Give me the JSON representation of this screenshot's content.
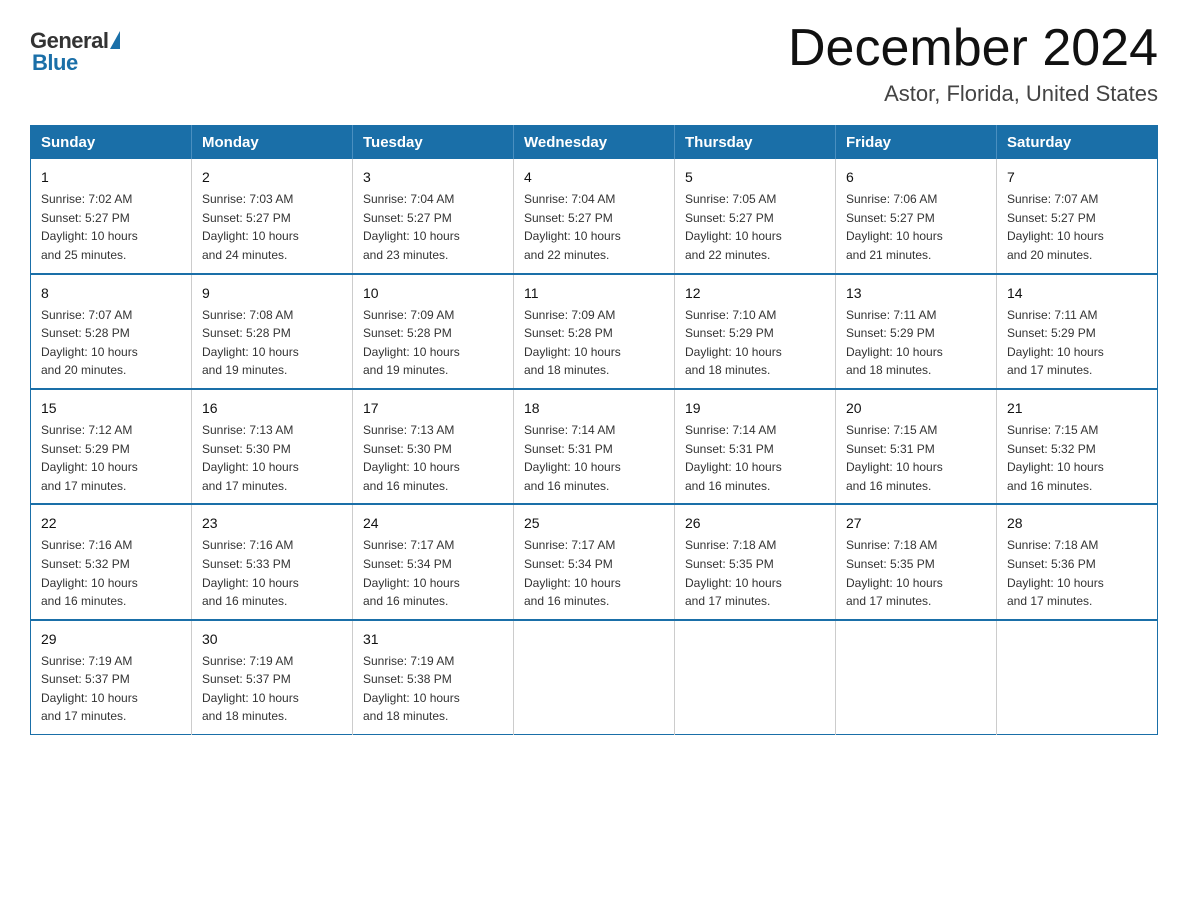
{
  "logo": {
    "text_general": "General",
    "text_blue": "Blue"
  },
  "title": {
    "month_year": "December 2024",
    "location": "Astor, Florida, United States"
  },
  "weekdays": [
    "Sunday",
    "Monday",
    "Tuesday",
    "Wednesday",
    "Thursday",
    "Friday",
    "Saturday"
  ],
  "weeks": [
    [
      {
        "day": "1",
        "sunrise": "7:02 AM",
        "sunset": "5:27 PM",
        "daylight": "10 hours and 25 minutes."
      },
      {
        "day": "2",
        "sunrise": "7:03 AM",
        "sunset": "5:27 PM",
        "daylight": "10 hours and 24 minutes."
      },
      {
        "day": "3",
        "sunrise": "7:04 AM",
        "sunset": "5:27 PM",
        "daylight": "10 hours and 23 minutes."
      },
      {
        "day": "4",
        "sunrise": "7:04 AM",
        "sunset": "5:27 PM",
        "daylight": "10 hours and 22 minutes."
      },
      {
        "day": "5",
        "sunrise": "7:05 AM",
        "sunset": "5:27 PM",
        "daylight": "10 hours and 22 minutes."
      },
      {
        "day": "6",
        "sunrise": "7:06 AM",
        "sunset": "5:27 PM",
        "daylight": "10 hours and 21 minutes."
      },
      {
        "day": "7",
        "sunrise": "7:07 AM",
        "sunset": "5:27 PM",
        "daylight": "10 hours and 20 minutes."
      }
    ],
    [
      {
        "day": "8",
        "sunrise": "7:07 AM",
        "sunset": "5:28 PM",
        "daylight": "10 hours and 20 minutes."
      },
      {
        "day": "9",
        "sunrise": "7:08 AM",
        "sunset": "5:28 PM",
        "daylight": "10 hours and 19 minutes."
      },
      {
        "day": "10",
        "sunrise": "7:09 AM",
        "sunset": "5:28 PM",
        "daylight": "10 hours and 19 minutes."
      },
      {
        "day": "11",
        "sunrise": "7:09 AM",
        "sunset": "5:28 PM",
        "daylight": "10 hours and 18 minutes."
      },
      {
        "day": "12",
        "sunrise": "7:10 AM",
        "sunset": "5:29 PM",
        "daylight": "10 hours and 18 minutes."
      },
      {
        "day": "13",
        "sunrise": "7:11 AM",
        "sunset": "5:29 PM",
        "daylight": "10 hours and 18 minutes."
      },
      {
        "day": "14",
        "sunrise": "7:11 AM",
        "sunset": "5:29 PM",
        "daylight": "10 hours and 17 minutes."
      }
    ],
    [
      {
        "day": "15",
        "sunrise": "7:12 AM",
        "sunset": "5:29 PM",
        "daylight": "10 hours and 17 minutes."
      },
      {
        "day": "16",
        "sunrise": "7:13 AM",
        "sunset": "5:30 PM",
        "daylight": "10 hours and 17 minutes."
      },
      {
        "day": "17",
        "sunrise": "7:13 AM",
        "sunset": "5:30 PM",
        "daylight": "10 hours and 16 minutes."
      },
      {
        "day": "18",
        "sunrise": "7:14 AM",
        "sunset": "5:31 PM",
        "daylight": "10 hours and 16 minutes."
      },
      {
        "day": "19",
        "sunrise": "7:14 AM",
        "sunset": "5:31 PM",
        "daylight": "10 hours and 16 minutes."
      },
      {
        "day": "20",
        "sunrise": "7:15 AM",
        "sunset": "5:31 PM",
        "daylight": "10 hours and 16 minutes."
      },
      {
        "day": "21",
        "sunrise": "7:15 AM",
        "sunset": "5:32 PM",
        "daylight": "10 hours and 16 minutes."
      }
    ],
    [
      {
        "day": "22",
        "sunrise": "7:16 AM",
        "sunset": "5:32 PM",
        "daylight": "10 hours and 16 minutes."
      },
      {
        "day": "23",
        "sunrise": "7:16 AM",
        "sunset": "5:33 PM",
        "daylight": "10 hours and 16 minutes."
      },
      {
        "day": "24",
        "sunrise": "7:17 AM",
        "sunset": "5:34 PM",
        "daylight": "10 hours and 16 minutes."
      },
      {
        "day": "25",
        "sunrise": "7:17 AM",
        "sunset": "5:34 PM",
        "daylight": "10 hours and 16 minutes."
      },
      {
        "day": "26",
        "sunrise": "7:18 AM",
        "sunset": "5:35 PM",
        "daylight": "10 hours and 17 minutes."
      },
      {
        "day": "27",
        "sunrise": "7:18 AM",
        "sunset": "5:35 PM",
        "daylight": "10 hours and 17 minutes."
      },
      {
        "day": "28",
        "sunrise": "7:18 AM",
        "sunset": "5:36 PM",
        "daylight": "10 hours and 17 minutes."
      }
    ],
    [
      {
        "day": "29",
        "sunrise": "7:19 AM",
        "sunset": "5:37 PM",
        "daylight": "10 hours and 17 minutes."
      },
      {
        "day": "30",
        "sunrise": "7:19 AM",
        "sunset": "5:37 PM",
        "daylight": "10 hours and 18 minutes."
      },
      {
        "day": "31",
        "sunrise": "7:19 AM",
        "sunset": "5:38 PM",
        "daylight": "10 hours and 18 minutes."
      },
      null,
      null,
      null,
      null
    ]
  ],
  "labels": {
    "sunrise": "Sunrise:",
    "sunset": "Sunset:",
    "daylight": "Daylight:"
  }
}
